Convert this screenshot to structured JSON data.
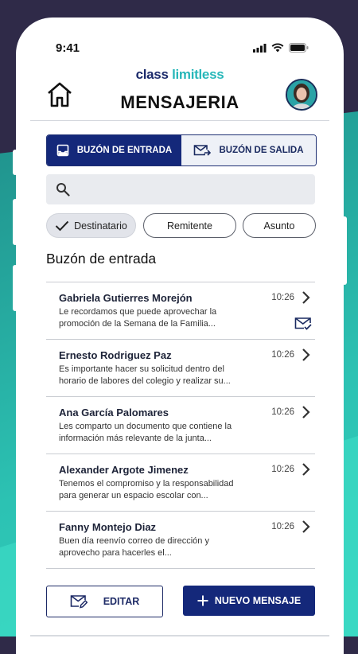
{
  "status_bar": {
    "time": "9:41"
  },
  "header": {
    "logo_part1": "class",
    "logo_part2": "limitless",
    "title": "MENSAJERIA"
  },
  "tabs": [
    {
      "label": "BUZÓN DE ENTRADA",
      "active": true
    },
    {
      "label": "BUZÓN DE SALIDA",
      "active": false
    }
  ],
  "search": {
    "placeholder": "",
    "value": ""
  },
  "filters": [
    {
      "label": "Destinatario",
      "selected": true
    },
    {
      "label": "Remitente",
      "selected": false
    },
    {
      "label": "Asunto",
      "selected": false
    }
  ],
  "section_title": "Buzón de entrada",
  "messages": [
    {
      "sender": "Gabriela Gutierres Morejón",
      "preview": "Le recordamos que puede aprovechar la promoción de la Semana de la Familia...",
      "time": "10:26",
      "read_icon": true
    },
    {
      "sender": "Ernesto Rodriguez Paz",
      "preview": "Es importante hacer su solicitud dentro del horario de labores del colegio y realizar su...",
      "time": "10:26",
      "read_icon": false
    },
    {
      "sender": "Ana García Palomares",
      "preview": "Les comparto un documento que contiene la información más relevante de la junta...",
      "time": "10:26",
      "read_icon": false
    },
    {
      "sender": "Alexander Argote Jimenez",
      "preview": "Tenemos el compromiso y la responsabilidad para generar un espacio escolar con...",
      "time": "10:26",
      "read_icon": false
    },
    {
      "sender": "Fanny Montejo Diaz",
      "preview": "Buen día reenvío correo de dirección y aprovecho para hacerles el...",
      "time": "10:26",
      "read_icon": false
    }
  ],
  "actions": {
    "edit_label": "EDITAR",
    "new_label": "NUEVO MENSAJE"
  },
  "colors": {
    "primary": "#14287a",
    "accent": "#27b7b9",
    "background": "#2f2a48"
  }
}
